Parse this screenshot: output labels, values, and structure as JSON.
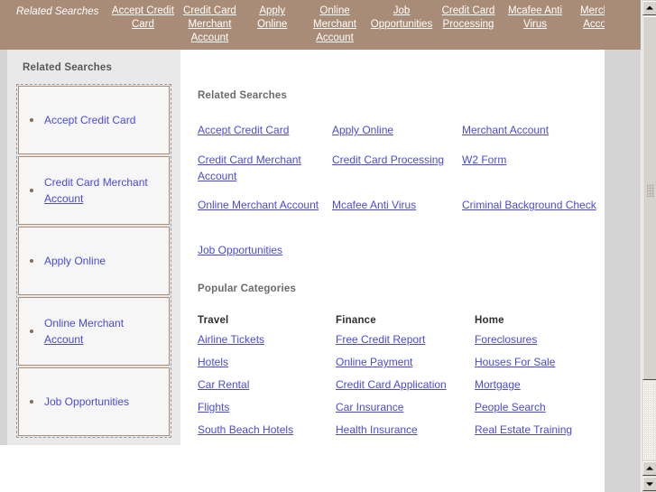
{
  "banner": {
    "title": "Related Searches",
    "links": [
      "Accept Credit Card",
      "Credit Card Merchant Account",
      "Apply Online",
      "Online Merchant Account",
      "Job Opportunities",
      "Credit Card Processing",
      "Mcafee Anti Virus",
      "Merchant Account"
    ]
  },
  "sidebar": {
    "heading": "Related Searches",
    "items": [
      {
        "line1": "Accept Credit Card",
        "line2": ""
      },
      {
        "line1": "Credit Card Merchant",
        "line2": "Account"
      },
      {
        "line1": "Apply Online",
        "line2": ""
      },
      {
        "line1": "Online Merchant",
        "line2": "Account"
      },
      {
        "line1": "Job Opportunities",
        "line2": ""
      }
    ]
  },
  "main": {
    "related_searches": {
      "heading": "Related Searches",
      "rows": [
        [
          "Accept Credit Card",
          "Apply Online",
          "Merchant Account"
        ],
        [
          "Credit Card Merchant Account",
          "Credit Card Processing",
          "W2 Form"
        ],
        [
          "Online Merchant Account",
          "Mcafee Anti Virus",
          "Criminal Background Check"
        ],
        [
          "Job Opportunities",
          "",
          ""
        ]
      ]
    },
    "popular_categories": {
      "heading": "Popular Categories",
      "columns": [
        {
          "title": "Travel",
          "items": [
            "Airline Tickets",
            "Hotels",
            "Car Rental",
            "Flights",
            "South Beach Hotels"
          ]
        },
        {
          "title": "Finance",
          "items": [
            "Free Credit Report",
            "Online Payment",
            "Credit Card Application",
            "Car Insurance",
            "Health Insurance"
          ]
        },
        {
          "title": "Home",
          "items": [
            "Foreclosures",
            "Houses For Sale",
            "Mortgage",
            "People Search",
            "Real Estate Training"
          ]
        }
      ]
    }
  },
  "scrollbar": {
    "up_arrow": "▲",
    "down_arrow": "▼"
  },
  "colors": {
    "banner_bg": "#a98c77",
    "link": "#4a4ad8",
    "sidebar_bg": "#e9e9e9",
    "item_border": "#ad8f79",
    "bullet": "#8d6a50"
  }
}
